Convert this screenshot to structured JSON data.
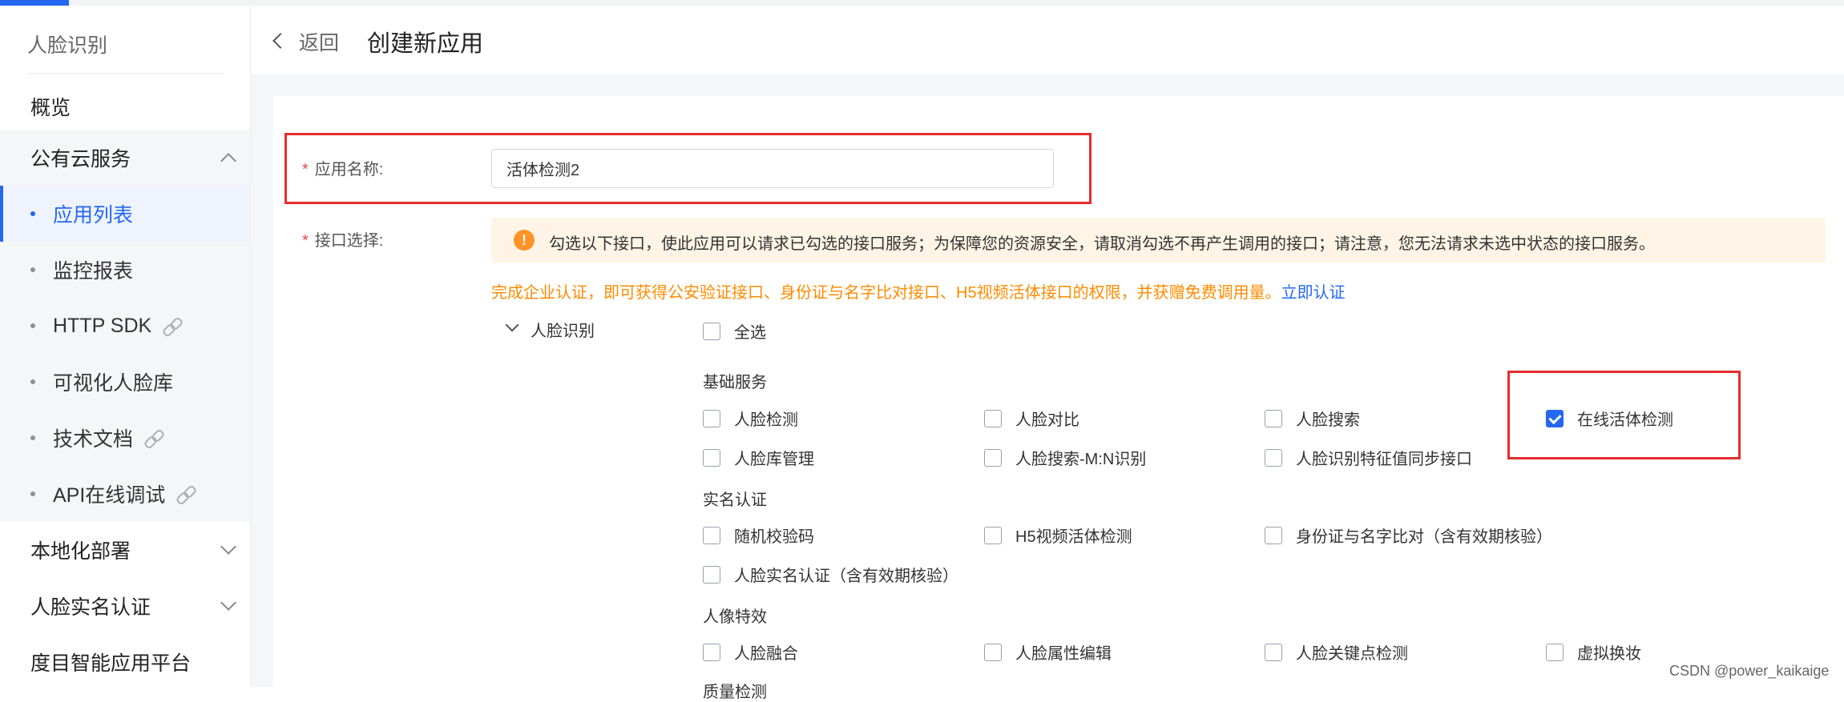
{
  "sidebar": {
    "title": "人脸识别",
    "items": [
      {
        "label": "概览"
      },
      {
        "label": "公有云服务"
      },
      {
        "label": "本地化部署"
      },
      {
        "label": "人脸实名认证"
      },
      {
        "label": "度目智能应用平台"
      }
    ],
    "public_cloud_sub": [
      {
        "label": "应用列表",
        "active": true
      },
      {
        "label": "监控报表"
      },
      {
        "label": "HTTP SDK",
        "external_icon": "link-icon"
      },
      {
        "label": "可视化人脸库"
      },
      {
        "label": "技术文档",
        "external_icon": "link-icon"
      },
      {
        "label": "API在线调试",
        "external_icon": "link-icon"
      }
    ]
  },
  "header": {
    "back_label": "返回",
    "title": "创建新应用"
  },
  "form": {
    "name_label": "应用名称:",
    "name_value": "活体检测2",
    "api_label": "接口选择:",
    "required_mark": "*",
    "notice": "勾选以下接口，使此应用可以请求已勾选的接口服务；为保障您的资源安全，请取消勾选不再产生调用的接口；请注意，您无法请求未选中状态的接口服务。",
    "notice_icon": "!",
    "cert_text": "完成企业认证，即可获得公安验证接口、身份证与名字比对接口、H5视频活体接口的权限，并获赠免费调用量。",
    "cert_link": "立即认证",
    "category": "人脸识别",
    "select_all": "全选",
    "sections": [
      {
        "title": "基础服务",
        "items": [
          {
            "label": "人脸检测",
            "checked": false
          },
          {
            "label": "人脸对比",
            "checked": false
          },
          {
            "label": "人脸搜索",
            "checked": false
          },
          {
            "label": "在线活体检测",
            "checked": true
          },
          {
            "label": "人脸库管理",
            "checked": false
          },
          {
            "label": "人脸搜索-M:N识别",
            "checked": false
          },
          {
            "label": "人脸识别特征值同步接口",
            "checked": false
          }
        ]
      },
      {
        "title": "实名认证",
        "items": [
          {
            "label": "随机校验码",
            "checked": false
          },
          {
            "label": "H5视频活体检测",
            "checked": false
          },
          {
            "label": "身份证与名字比对（含有效期核验）",
            "checked": false
          },
          {
            "label": "人脸实名认证（含有效期核验）",
            "checked": false
          }
        ]
      },
      {
        "title": "人像特效",
        "items": [
          {
            "label": "人脸融合",
            "checked": false
          },
          {
            "label": "人脸属性编辑",
            "checked": false
          },
          {
            "label": "人脸关键点检测",
            "checked": false
          },
          {
            "label": "虚拟换妆",
            "checked": false
          }
        ]
      },
      {
        "title": "质量检测"
      }
    ]
  },
  "watermark": "CSDN @power_kaikaige",
  "colors": {
    "accent": "#2468f2",
    "highlight_box": "#e52d2d",
    "warning": "#ff9326",
    "cert_text": "#ff8a00"
  }
}
